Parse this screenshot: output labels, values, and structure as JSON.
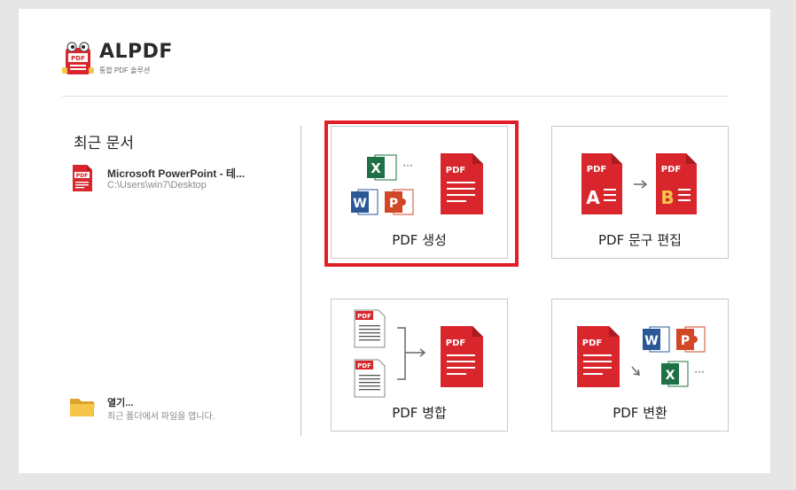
{
  "brand": {
    "name": "ALPDF",
    "tagline": "통합 PDF 솔루션",
    "logo_text": "PDF"
  },
  "recent": {
    "title": "최근 문서",
    "items": [
      {
        "name": "Microsoft PowerPoint - 테...",
        "path": "C:\\Users\\win7\\Desktop",
        "icon": "pdf-file-icon"
      }
    ]
  },
  "open": {
    "label": "열기...",
    "desc": "최근 폴더에서 파일을 엽니다.",
    "icon": "folder-icon"
  },
  "tiles": [
    {
      "id": "create",
      "label": "PDF 생성",
      "selected": true
    },
    {
      "id": "edit",
      "label": "PDF 문구 편집",
      "selected": false
    },
    {
      "id": "merge",
      "label": "PDF 병합",
      "selected": false
    },
    {
      "id": "convert",
      "label": "PDF 변환",
      "selected": false
    }
  ],
  "icon_text": {
    "pdf": "PDF",
    "excel": "X",
    "word": "W",
    "ppt": "P",
    "ellipsis": "···",
    "letter_a": "A",
    "letter_b": "B"
  },
  "colors": {
    "pdf_red": "#d8262c",
    "pdf_red_dark": "#a81b20",
    "excel_green": "#1e7145",
    "word_blue": "#2b5797",
    "ppt_orange": "#d24726",
    "highlight": "#e21e26",
    "folder": "#f3b43c",
    "letter_b": "#f6c64a"
  }
}
